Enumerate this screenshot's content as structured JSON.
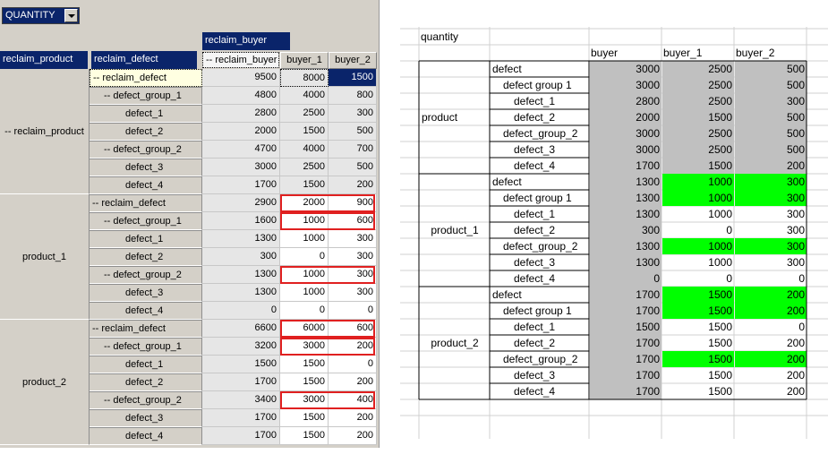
{
  "pivot": {
    "page_field": "QUANTITY",
    "column_field": "reclaim_buyer",
    "row_fields": [
      "reclaim_product",
      "reclaim_defect"
    ],
    "columns": [
      "-- reclaim_buyer",
      "buyer_1",
      "buyer_2"
    ],
    "groups": [
      {
        "product": "-- reclaim_product",
        "rows": [
          {
            "label": "-- reclaim_defect",
            "values": [
              "9500",
              "8000",
              "1500"
            ]
          },
          {
            "label": "-- defect_group_1",
            "values": [
              "4800",
              "4000",
              "800"
            ]
          },
          {
            "label": "defect_1",
            "values": [
              "2800",
              "2500",
              "300"
            ]
          },
          {
            "label": "defect_2",
            "values": [
              "2000",
              "1500",
              "500"
            ]
          },
          {
            "label": "-- defect_group_2",
            "values": [
              "4700",
              "4000",
              "700"
            ]
          },
          {
            "label": "defect_3",
            "values": [
              "3000",
              "2500",
              "500"
            ]
          },
          {
            "label": "defect_4",
            "values": [
              "1700",
              "1500",
              "200"
            ]
          }
        ]
      },
      {
        "product": "product_1",
        "rows": [
          {
            "label": "-- reclaim_defect",
            "values": [
              "2900",
              "2000",
              "900"
            ]
          },
          {
            "label": "-- defect_group_1",
            "values": [
              "1600",
              "1000",
              "600"
            ]
          },
          {
            "label": "defect_1",
            "values": [
              "1300",
              "1000",
              "300"
            ]
          },
          {
            "label": "defect_2",
            "values": [
              "300",
              "0",
              "300"
            ]
          },
          {
            "label": "-- defect_group_2",
            "values": [
              "1300",
              "1000",
              "300"
            ]
          },
          {
            "label": "defect_3",
            "values": [
              "1300",
              "1000",
              "300"
            ]
          },
          {
            "label": "defect_4",
            "values": [
              "0",
              "0",
              "0"
            ]
          }
        ]
      },
      {
        "product": "product_2",
        "rows": [
          {
            "label": "-- reclaim_defect",
            "values": [
              "6600",
              "6000",
              "600"
            ]
          },
          {
            "label": "-- defect_group_1",
            "values": [
              "3200",
              "3000",
              "200"
            ]
          },
          {
            "label": "defect_1",
            "values": [
              "1500",
              "1500",
              "0"
            ]
          },
          {
            "label": "defect_2",
            "values": [
              "1700",
              "1500",
              "200"
            ]
          },
          {
            "label": "-- defect_group_2",
            "values": [
              "3400",
              "3000",
              "400"
            ]
          },
          {
            "label": "defect_3",
            "values": [
              "1700",
              "1500",
              "200"
            ]
          },
          {
            "label": "defect_4",
            "values": [
              "1700",
              "1500",
              "200"
            ]
          }
        ]
      }
    ],
    "highlighted_rows_red": [
      [
        1,
        0
      ],
      [
        1,
        1
      ],
      [
        1,
        4
      ],
      [
        2,
        0
      ],
      [
        2,
        1
      ],
      [
        2,
        4
      ]
    ]
  },
  "sheet": {
    "title": "quantity",
    "columns": [
      "buyer",
      "buyer_1",
      "buyer_2"
    ],
    "groups": [
      {
        "product": "product",
        "rows": [
          {
            "label": "defect",
            "indent": 0,
            "values": [
              "3000",
              "2500",
              "500"
            ],
            "fill": "gray"
          },
          {
            "label": "defect group 1",
            "indent": 1,
            "values": [
              "3000",
              "2500",
              "500"
            ],
            "fill": "gray"
          },
          {
            "label": "defect_1",
            "indent": 2,
            "values": [
              "2800",
              "2500",
              "300"
            ],
            "fill": "gray"
          },
          {
            "label": "defect_2",
            "indent": 2,
            "values": [
              "2000",
              "1500",
              "500"
            ],
            "fill": "gray"
          },
          {
            "label": "defect_group_2",
            "indent": 1,
            "values": [
              "3000",
              "2500",
              "500"
            ],
            "fill": "gray"
          },
          {
            "label": "defect_3",
            "indent": 2,
            "values": [
              "3000",
              "2500",
              "500"
            ],
            "fill": "gray"
          },
          {
            "label": "defect_4",
            "indent": 2,
            "values": [
              "1700",
              "1500",
              "200"
            ],
            "fill": "gray"
          }
        ]
      },
      {
        "product": "product_1",
        "rows": [
          {
            "label": "defect",
            "indent": 0,
            "values": [
              "1300",
              "1000",
              "300"
            ],
            "fill": "green"
          },
          {
            "label": "defect group 1",
            "indent": 1,
            "values": [
              "1300",
              "1000",
              "300"
            ],
            "fill": "green"
          },
          {
            "label": "defect_1",
            "indent": 2,
            "values": [
              "1300",
              "1000",
              "300"
            ],
            "fill": "none"
          },
          {
            "label": "defect_2",
            "indent": 2,
            "values": [
              "300",
              "0",
              "300"
            ],
            "fill": "none"
          },
          {
            "label": "defect_group_2",
            "indent": 1,
            "values": [
              "1300",
              "1000",
              "300"
            ],
            "fill": "green"
          },
          {
            "label": "defect_3",
            "indent": 2,
            "values": [
              "1300",
              "1000",
              "300"
            ],
            "fill": "none"
          },
          {
            "label": "defect_4",
            "indent": 2,
            "values": [
              "0",
              "0",
              "0"
            ],
            "fill": "none"
          }
        ]
      },
      {
        "product": "product_2",
        "rows": [
          {
            "label": "defect",
            "indent": 0,
            "values": [
              "1700",
              "1500",
              "200"
            ],
            "fill": "green"
          },
          {
            "label": "defect group 1",
            "indent": 1,
            "values": [
              "1700",
              "1500",
              "200"
            ],
            "fill": "green"
          },
          {
            "label": "defect_1",
            "indent": 2,
            "values": [
              "1500",
              "1500",
              "0"
            ],
            "fill": "none"
          },
          {
            "label": "defect_2",
            "indent": 2,
            "values": [
              "1700",
              "1500",
              "200"
            ],
            "fill": "none"
          },
          {
            "label": "defect_group_2",
            "indent": 1,
            "values": [
              "1700",
              "1500",
              "200"
            ],
            "fill": "green"
          },
          {
            "label": "defect_3",
            "indent": 2,
            "values": [
              "1700",
              "1500",
              "200"
            ],
            "fill": "none"
          },
          {
            "label": "defect_4",
            "indent": 2,
            "values": [
              "1700",
              "1500",
              "200"
            ],
            "fill": "none"
          }
        ]
      }
    ]
  },
  "colors": {
    "header_blue": "#0a246a",
    "panel_gray": "#d4d0c8",
    "cell_gray": "#c0c0c0",
    "cell_green": "#00ff00",
    "red_outline": "#e02020",
    "selected_yellow": "#ffffe1"
  }
}
